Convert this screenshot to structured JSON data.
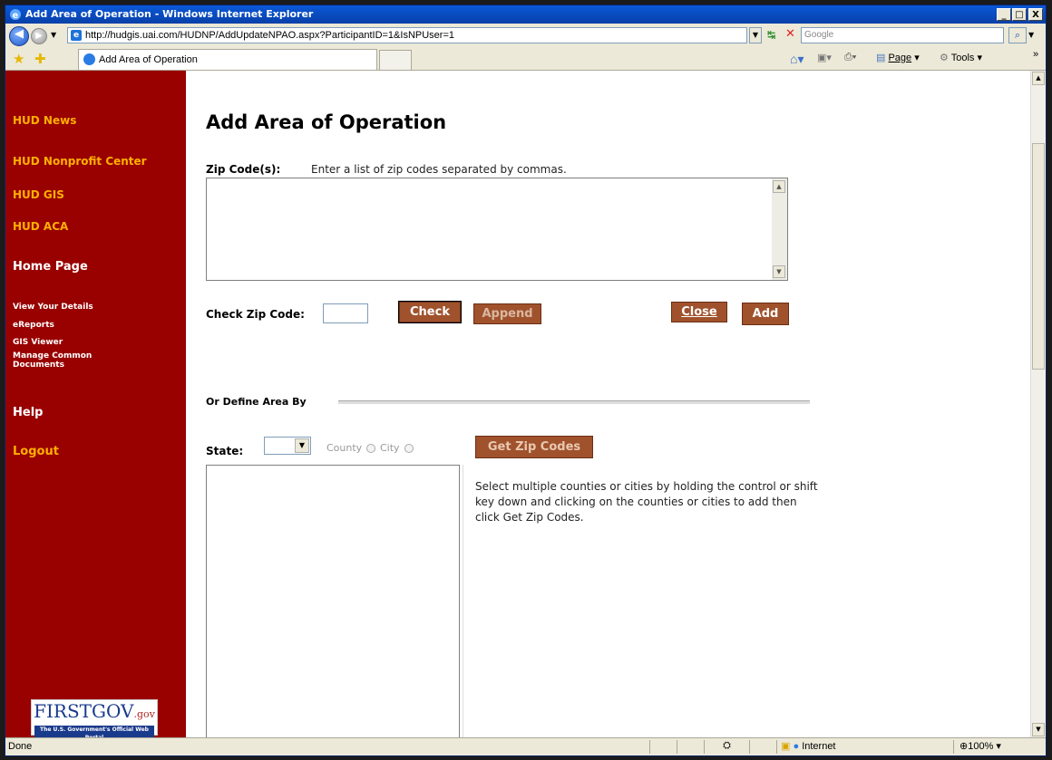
{
  "window": {
    "title": "Add Area of Operation - Windows Internet Explorer",
    "minimize": "_",
    "maximize": "□",
    "close": "X"
  },
  "addressbar": {
    "url": "http://hudgis.uai.com/HUDNP/AddUpdateNPAO.aspx?ParticipantID=1&IsNPUser=1",
    "search_placeholder": "Google"
  },
  "tabs": {
    "active_label": "Add Area of Operation"
  },
  "commandbar": {
    "page": "Page",
    "tools": "Tools",
    "chevron": "»"
  },
  "sidebar": {
    "top_links": [
      "HUD News",
      "HUD Nonprofit Center",
      "HUD GIS",
      "HUD ACA"
    ],
    "home": "Home Page",
    "sub_links": [
      "View Your Details",
      "eReports",
      "GIS Viewer",
      "Manage Common Documents"
    ],
    "help": "Help",
    "logout": "Logout",
    "logo_text": "FIRSTGOV",
    "logo_suffix": ".gov",
    "logo_tagline": "The U.S. Government's Official Web Portal"
  },
  "form": {
    "title": "Add Area of Operation",
    "zip_label": "Zip Code(s):",
    "zip_hint": "Enter a list of zip codes separated by commas.",
    "check_zip_label": "Check Zip Code:",
    "check_button": "Check",
    "append_button": "Append",
    "close_button": "Close",
    "add_button": "Add",
    "define_area_label": "Or Define Area By",
    "state_label": "State:",
    "county_label": "County",
    "city_label": "City",
    "get_zip_button": "Get Zip Codes",
    "instructions": "Select multiple counties or cities by holding the control or shift key down and clicking on the counties or cities to add then click Get Zip Codes."
  },
  "statusbar": {
    "status": "Done",
    "zone": "Internet",
    "zoom": "100%"
  }
}
